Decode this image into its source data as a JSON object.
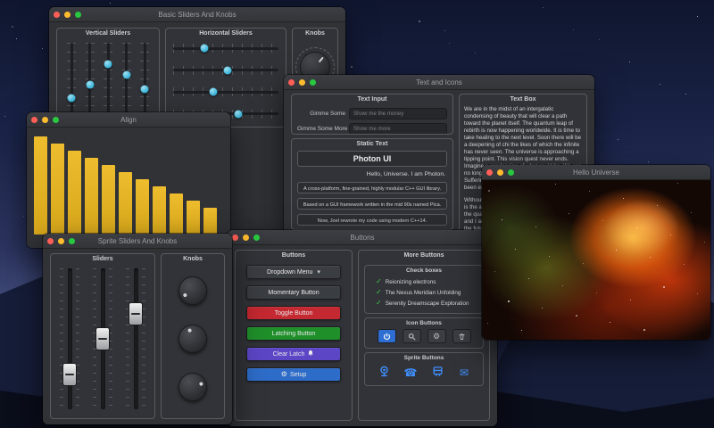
{
  "colors": {
    "slider_thumb": "#35b0d8",
    "check": "#43c94a",
    "sprite_icon": "#3f8fff",
    "icon_active_bg": "#2e6ed2"
  },
  "windows": {
    "basic_sliders": {
      "title": "Basic Sliders And Knobs",
      "groups": {
        "vertical": {
          "title": "Vertical Sliders",
          "values_pct": [
            28,
            45,
            72,
            58,
            40
          ]
        },
        "horizontal": {
          "title": "Horizontal Sliders",
          "values_pct": [
            30,
            52,
            38,
            62
          ]
        },
        "knobs": {
          "title": "Knobs",
          "angle_deg": 40
        }
      }
    },
    "align": {
      "title": "Align",
      "bar_color": "#d7a71b",
      "bar_count": 11
    },
    "sprite_sliders": {
      "title": "Sprite Sliders And Knobs",
      "groups": {
        "sliders": {
          "title": "Sliders",
          "values_pct": [
            25,
            50,
            68
          ]
        },
        "knobs": {
          "title": "Knobs",
          "angles_deg": [
            -120,
            -20,
            70
          ]
        }
      }
    },
    "text_icons": {
      "title": "Text and Icons",
      "text_input": {
        "title": "Text Input",
        "rows": [
          {
            "label": "Gimme Some",
            "placeholder": "Show me the money"
          },
          {
            "label": "Gimme Some More",
            "placeholder": "Show me more"
          }
        ]
      },
      "static_text": {
        "title": "Static Text",
        "heading": "Photon UI",
        "subheading": "Hello, Universe. I am Photon.",
        "lines": [
          "A cross-platform, fine-grained, highly modular C++ GUI library.",
          "Based on a GUI framework written in the mid 90s named Pica.",
          "Now, Joel rewrote my code using modern C++14."
        ]
      },
      "text_box": {
        "title": "Text Box",
        "para1": "We are in the midst of an intergalatic condensing of beauty that will clear a path toward the planet itself. The quantum leap of rebirth is now happening worldwide. It is time to take healing to the next level. Soon there will be a deepening of chi the likes of which the infinite has never seen. The universe is approaching a tipping point. This vision quest never ends. Imagine a condensing of what could be. We can no longer afford to live with stagnation. Suffering is born in the gap where wellbeing has been excluded.",
        "para2": "Without stillness, one cannot exist. Stagnation is the antithesis of wellbeing. Only seekers of the quantum cycle may create wellbeing. You and I are messengers of the third reality, and the future will be a deepening of wellbeing the likes of which the cosmos has never seen."
      }
    },
    "buttons": {
      "title": "Buttons",
      "buttons_group": {
        "title": "Buttons",
        "items": [
          {
            "id": "dropdown-menu-button",
            "label": "Dropdown Menu",
            "caret": true
          },
          {
            "id": "momentary-button",
            "label": "Momentary Button"
          },
          {
            "id": "toggle-button",
            "label": "Toggle Button",
            "color": "#c42830"
          },
          {
            "id": "latching-button",
            "label": "Latching Button",
            "color": "#1f8f2a"
          },
          {
            "id": "clear-latch-button",
            "label": "Clear Latch",
            "color": "#5c46c6",
            "icon": "bell"
          },
          {
            "id": "setup-button",
            "label": "Setup",
            "color": "#2d6cc8",
            "icon": "cog"
          }
        ]
      },
      "more_buttons_group": {
        "title": "More Buttons",
        "check_boxes": {
          "title": "Check boxes",
          "items": [
            {
              "label": "Reionizing electrons",
              "checked": true
            },
            {
              "label": "The Nexus Meridian Unfolding",
              "checked": true
            },
            {
              "label": "Serenity Dreamscape Exploration",
              "checked": true
            }
          ]
        },
        "icon_buttons": {
          "title": "Icon Buttons",
          "items": [
            {
              "icon": "power",
              "active": true
            },
            {
              "icon": "magnifying-glass",
              "active": false
            },
            {
              "icon": "cog",
              "active": false
            },
            {
              "icon": "trash",
              "active": false
            }
          ]
        },
        "sprite_buttons": {
          "title": "Sprite Buttons",
          "items": [
            {
              "icon": "camera"
            },
            {
              "icon": "phone"
            },
            {
              "icon": "bus"
            },
            {
              "icon": "mail"
            }
          ]
        }
      }
    },
    "image_window": {
      "title": "Hello Universe"
    }
  }
}
